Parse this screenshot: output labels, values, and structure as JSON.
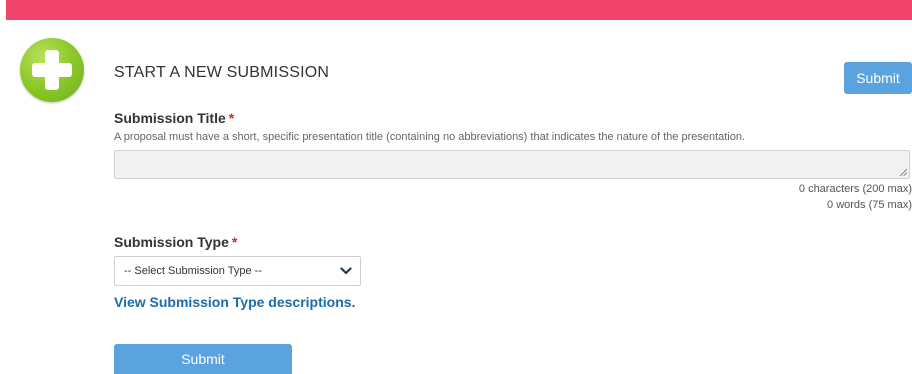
{
  "header": {
    "accent_color": "#f0446d",
    "icon": "plus-circle-icon",
    "title": "START A NEW SUBMISSION",
    "submit_label": "Submit"
  },
  "form": {
    "title_field": {
      "label": "Submission Title",
      "required_mark": "*",
      "help": "A proposal must have a short, specific presentation title (containing no abbreviations) that indicates the nature of the presentation.",
      "value": "",
      "char_count": "0 characters (200 max)",
      "word_count": "0 words (75 max)"
    },
    "type_field": {
      "label": "Submission Type",
      "required_mark": "*",
      "selected": "-- Select Submission Type --"
    },
    "descriptions_link": "View Submission Type descriptions.",
    "submit_label": "Submit"
  },
  "colors": {
    "button": "#5aa3df",
    "link": "#1b6cad",
    "required": "#d9242c",
    "badge": "#8fcb2c"
  }
}
